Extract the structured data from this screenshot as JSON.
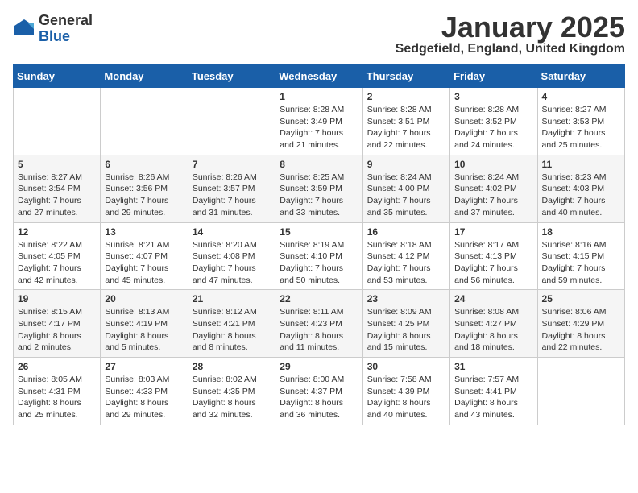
{
  "header": {
    "logo_line1": "General",
    "logo_line2": "Blue",
    "month": "January 2025",
    "location": "Sedgefield, England, United Kingdom"
  },
  "weekdays": [
    "Sunday",
    "Monday",
    "Tuesday",
    "Wednesday",
    "Thursday",
    "Friday",
    "Saturday"
  ],
  "weeks": [
    [
      {
        "day": "",
        "info": ""
      },
      {
        "day": "",
        "info": ""
      },
      {
        "day": "",
        "info": ""
      },
      {
        "day": "1",
        "info": "Sunrise: 8:28 AM\nSunset: 3:49 PM\nDaylight: 7 hours\nand 21 minutes."
      },
      {
        "day": "2",
        "info": "Sunrise: 8:28 AM\nSunset: 3:51 PM\nDaylight: 7 hours\nand 22 minutes."
      },
      {
        "day": "3",
        "info": "Sunrise: 8:28 AM\nSunset: 3:52 PM\nDaylight: 7 hours\nand 24 minutes."
      },
      {
        "day": "4",
        "info": "Sunrise: 8:27 AM\nSunset: 3:53 PM\nDaylight: 7 hours\nand 25 minutes."
      }
    ],
    [
      {
        "day": "5",
        "info": "Sunrise: 8:27 AM\nSunset: 3:54 PM\nDaylight: 7 hours\nand 27 minutes."
      },
      {
        "day": "6",
        "info": "Sunrise: 8:26 AM\nSunset: 3:56 PM\nDaylight: 7 hours\nand 29 minutes."
      },
      {
        "day": "7",
        "info": "Sunrise: 8:26 AM\nSunset: 3:57 PM\nDaylight: 7 hours\nand 31 minutes."
      },
      {
        "day": "8",
        "info": "Sunrise: 8:25 AM\nSunset: 3:59 PM\nDaylight: 7 hours\nand 33 minutes."
      },
      {
        "day": "9",
        "info": "Sunrise: 8:24 AM\nSunset: 4:00 PM\nDaylight: 7 hours\nand 35 minutes."
      },
      {
        "day": "10",
        "info": "Sunrise: 8:24 AM\nSunset: 4:02 PM\nDaylight: 7 hours\nand 37 minutes."
      },
      {
        "day": "11",
        "info": "Sunrise: 8:23 AM\nSunset: 4:03 PM\nDaylight: 7 hours\nand 40 minutes."
      }
    ],
    [
      {
        "day": "12",
        "info": "Sunrise: 8:22 AM\nSunset: 4:05 PM\nDaylight: 7 hours\nand 42 minutes."
      },
      {
        "day": "13",
        "info": "Sunrise: 8:21 AM\nSunset: 4:07 PM\nDaylight: 7 hours\nand 45 minutes."
      },
      {
        "day": "14",
        "info": "Sunrise: 8:20 AM\nSunset: 4:08 PM\nDaylight: 7 hours\nand 47 minutes."
      },
      {
        "day": "15",
        "info": "Sunrise: 8:19 AM\nSunset: 4:10 PM\nDaylight: 7 hours\nand 50 minutes."
      },
      {
        "day": "16",
        "info": "Sunrise: 8:18 AM\nSunset: 4:12 PM\nDaylight: 7 hours\nand 53 minutes."
      },
      {
        "day": "17",
        "info": "Sunrise: 8:17 AM\nSunset: 4:13 PM\nDaylight: 7 hours\nand 56 minutes."
      },
      {
        "day": "18",
        "info": "Sunrise: 8:16 AM\nSunset: 4:15 PM\nDaylight: 7 hours\nand 59 minutes."
      }
    ],
    [
      {
        "day": "19",
        "info": "Sunrise: 8:15 AM\nSunset: 4:17 PM\nDaylight: 8 hours\nand 2 minutes."
      },
      {
        "day": "20",
        "info": "Sunrise: 8:13 AM\nSunset: 4:19 PM\nDaylight: 8 hours\nand 5 minutes."
      },
      {
        "day": "21",
        "info": "Sunrise: 8:12 AM\nSunset: 4:21 PM\nDaylight: 8 hours\nand 8 minutes."
      },
      {
        "day": "22",
        "info": "Sunrise: 8:11 AM\nSunset: 4:23 PM\nDaylight: 8 hours\nand 11 minutes."
      },
      {
        "day": "23",
        "info": "Sunrise: 8:09 AM\nSunset: 4:25 PM\nDaylight: 8 hours\nand 15 minutes."
      },
      {
        "day": "24",
        "info": "Sunrise: 8:08 AM\nSunset: 4:27 PM\nDaylight: 8 hours\nand 18 minutes."
      },
      {
        "day": "25",
        "info": "Sunrise: 8:06 AM\nSunset: 4:29 PM\nDaylight: 8 hours\nand 22 minutes."
      }
    ],
    [
      {
        "day": "26",
        "info": "Sunrise: 8:05 AM\nSunset: 4:31 PM\nDaylight: 8 hours\nand 25 minutes."
      },
      {
        "day": "27",
        "info": "Sunrise: 8:03 AM\nSunset: 4:33 PM\nDaylight: 8 hours\nand 29 minutes."
      },
      {
        "day": "28",
        "info": "Sunrise: 8:02 AM\nSunset: 4:35 PM\nDaylight: 8 hours\nand 32 minutes."
      },
      {
        "day": "29",
        "info": "Sunrise: 8:00 AM\nSunset: 4:37 PM\nDaylight: 8 hours\nand 36 minutes."
      },
      {
        "day": "30",
        "info": "Sunrise: 7:58 AM\nSunset: 4:39 PM\nDaylight: 8 hours\nand 40 minutes."
      },
      {
        "day": "31",
        "info": "Sunrise: 7:57 AM\nSunset: 4:41 PM\nDaylight: 8 hours\nand 43 minutes."
      },
      {
        "day": "",
        "info": ""
      }
    ]
  ]
}
